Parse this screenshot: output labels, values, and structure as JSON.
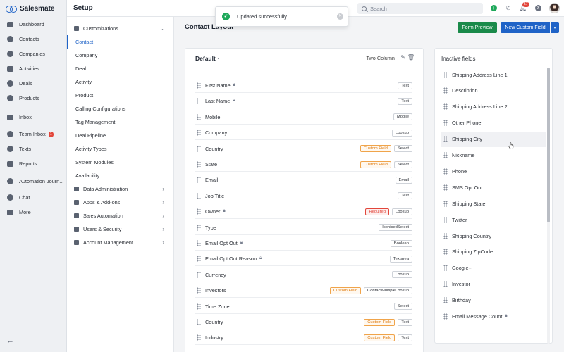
{
  "brand": {
    "name": "Salesmate"
  },
  "leftnav": {
    "items": [
      {
        "label": "Dashboard",
        "icon": "dashboard-icon"
      },
      {
        "label": "Contacts",
        "icon": "contacts-icon"
      },
      {
        "label": "Companies",
        "icon": "companies-icon"
      },
      {
        "label": "Activities",
        "icon": "activities-icon"
      },
      {
        "label": "Deals",
        "icon": "deals-icon"
      },
      {
        "label": "Products",
        "icon": "products-icon"
      },
      {
        "label": "Inbox",
        "icon": "inbox-icon"
      },
      {
        "label": "Team Inbox",
        "icon": "team-inbox-icon",
        "badge": "1"
      },
      {
        "label": "Texts",
        "icon": "texts-icon"
      },
      {
        "label": "Reports",
        "icon": "reports-icon"
      },
      {
        "label": "Automation Journ...",
        "icon": "automation-icon"
      },
      {
        "label": "Chat",
        "icon": "chat-icon"
      },
      {
        "label": "More",
        "icon": "more-icon"
      }
    ]
  },
  "topbar": {
    "title": "Setup",
    "search_placeholder": "Search",
    "notification_count": "57"
  },
  "toast": {
    "message": "Updated successfully."
  },
  "setupnav": {
    "section": "Customizations",
    "items": [
      {
        "label": "Contact",
        "active": true
      },
      {
        "label": "Company"
      },
      {
        "label": "Deal"
      },
      {
        "label": "Activity"
      },
      {
        "label": "Product"
      },
      {
        "label": "Calling Configurations"
      },
      {
        "label": "Tag Management"
      },
      {
        "label": "Deal Pipeline"
      },
      {
        "label": "Activity Types"
      },
      {
        "label": "System Modules"
      },
      {
        "label": "Availability"
      }
    ],
    "groups": [
      {
        "label": "Data Administration"
      },
      {
        "label": "Apps & Add-ons"
      },
      {
        "label": "Sales Automation"
      },
      {
        "label": "Users & Security"
      },
      {
        "label": "Account Management"
      }
    ]
  },
  "main": {
    "title": "Contact Layout",
    "form_preview_label": "Form Preview",
    "new_field_label": "New Custom Field",
    "layout": {
      "name": "Default",
      "mode": "Two Column"
    },
    "fields": [
      {
        "label": "First Name",
        "locked": true,
        "tags": [
          {
            "text": "Text"
          }
        ]
      },
      {
        "label": "Last Name",
        "locked": true,
        "tags": [
          {
            "text": "Text"
          }
        ]
      },
      {
        "label": "Mobile",
        "tags": [
          {
            "text": "Mobile"
          }
        ]
      },
      {
        "label": "Company",
        "tags": [
          {
            "text": "Lookup"
          }
        ]
      },
      {
        "label": "Country",
        "tags": [
          {
            "text": "Custom Field",
            "kind": "custom"
          },
          {
            "text": "Select"
          }
        ]
      },
      {
        "label": "State",
        "tags": [
          {
            "text": "Custom Field",
            "kind": "custom"
          },
          {
            "text": "Select"
          }
        ]
      },
      {
        "label": "Email",
        "tags": [
          {
            "text": "Email"
          }
        ]
      },
      {
        "label": "Job Title",
        "tags": [
          {
            "text": "Text"
          }
        ]
      },
      {
        "label": "Owner",
        "locked": true,
        "tags": [
          {
            "text": "Required",
            "kind": "required"
          },
          {
            "text": "Lookup"
          }
        ]
      },
      {
        "label": "Type",
        "tags": [
          {
            "text": "IconisedSelect"
          }
        ]
      },
      {
        "label": "Email Opt Out",
        "locked": true,
        "tags": [
          {
            "text": "Boolean"
          }
        ]
      },
      {
        "label": "Email Opt Out Reason",
        "locked": true,
        "tags": [
          {
            "text": "Textarea"
          }
        ]
      },
      {
        "label": "Currency",
        "tags": [
          {
            "text": "Lookup"
          }
        ]
      },
      {
        "label": "Investors",
        "tags": [
          {
            "text": "Custom Field",
            "kind": "custom"
          },
          {
            "text": "ContactMultipleLookup"
          }
        ]
      },
      {
        "label": "Time Zone",
        "tags": [
          {
            "text": "Select"
          }
        ]
      },
      {
        "label": "Country",
        "tags": [
          {
            "text": "Custom Field",
            "kind": "custom"
          },
          {
            "text": "Text"
          }
        ]
      },
      {
        "label": "Industry",
        "tags": [
          {
            "text": "Custom Field",
            "kind": "custom"
          },
          {
            "text": "Text"
          }
        ]
      }
    ],
    "inactive": {
      "title": "Inactive fields",
      "items": [
        {
          "label": "Shipping Address Line 1"
        },
        {
          "label": "Description"
        },
        {
          "label": "Shipping Address Line 2"
        },
        {
          "label": "Other Phone"
        },
        {
          "label": "Shipping City",
          "hover": true
        },
        {
          "label": "Nickname"
        },
        {
          "label": "Phone"
        },
        {
          "label": "SMS Opt Out"
        },
        {
          "label": "Shipping State"
        },
        {
          "label": "Twitter"
        },
        {
          "label": "Shipping Country"
        },
        {
          "label": "Shipping ZipCode"
        },
        {
          "label": "Google+"
        },
        {
          "label": "Investor"
        },
        {
          "label": "Birthday"
        },
        {
          "label": "Email Message Count",
          "locked": true
        }
      ]
    }
  },
  "colors": {
    "primary": "#1f63c7",
    "success": "#1a8a4a",
    "custom": "#e07c10",
    "required": "#e2463b"
  }
}
